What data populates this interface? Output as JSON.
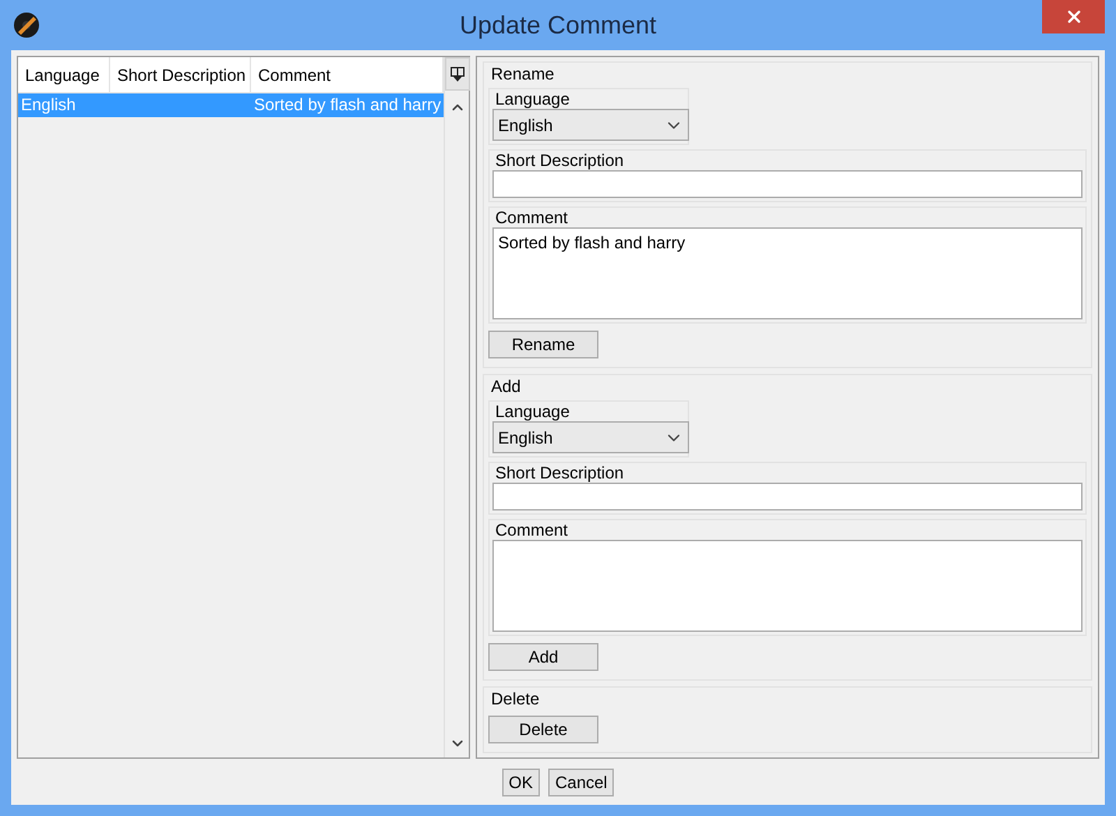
{
  "window": {
    "title": "Update Comment"
  },
  "table": {
    "columns": [
      "Language",
      "Short Description",
      "Comment"
    ],
    "rows": [
      {
        "cells": [
          "English",
          "",
          "Sorted by flash and harry"
        ],
        "selected": true
      }
    ]
  },
  "rename": {
    "title": "Rename",
    "language": {
      "label": "Language",
      "value": "English"
    },
    "short_description": {
      "label": "Short Description"
    },
    "comment": {
      "label": "Comment",
      "value": "Sorted by flash and harry"
    },
    "button": "Rename"
  },
  "add": {
    "title": "Add",
    "language": {
      "label": "Language",
      "value": "English"
    },
    "short_description": {
      "label": "Short Description"
    },
    "comment": {
      "label": "Comment"
    },
    "button": "Add"
  },
  "delete": {
    "title": "Delete",
    "button": "Delete"
  },
  "buttons": [
    "OK",
    "Cancel"
  ]
}
